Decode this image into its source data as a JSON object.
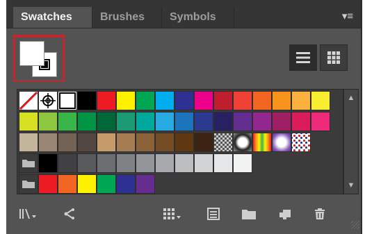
{
  "panel": {
    "tabs": [
      {
        "label": "Swatches",
        "active": true
      },
      {
        "label": "Brushes",
        "active": false
      },
      {
        "label": "Symbols",
        "active": false
      }
    ],
    "menu_icon": "panel-menu-icon"
  },
  "fill_stroke": {
    "fill_color": "#ffffff",
    "stroke_color": "#000000",
    "highlight_color": "#c1272d"
  },
  "view_modes": [
    {
      "name": "list-view",
      "icon": "list-view-icon",
      "active": true
    },
    {
      "name": "thumbnail-view",
      "icon": "thumbnail-view-icon",
      "active": false
    }
  ],
  "swatch_rows": [
    [
      "none",
      "registration",
      "#ffffff",
      "#000000",
      "#ed1c24",
      "#fff200",
      "#00a651",
      "#00aeef",
      "#2e3192",
      "#ec008c",
      "#be1e2d",
      "#ef4136",
      "#f26522",
      "#f7941d",
      "#fbb040",
      "#f9ed32"
    ],
    [
      "#d7df23",
      "#8dc63f",
      "#39b54a",
      "#009444",
      "#006838",
      "#1c9a73",
      "#00a79d",
      "#27aae1",
      "#1c75bc",
      "#2b3990",
      "#262262",
      "#662d91",
      "#92278f",
      "#9e1f63",
      "#da1c5c",
      "#ee2a7b"
    ],
    [
      "#c2b59b",
      "#998675",
      "#736357",
      "#534741",
      "#c69c6d",
      "#a67c52",
      "#8c6239",
      "#754c24",
      "#603913",
      "#3c2415",
      "pattern-checker",
      "pattern-radial",
      "pattern-stripes",
      "pattern-glow",
      "pattern-dots"
    ],
    [
      "folder",
      "#000000",
      "#414042",
      "#58595b",
      "#6d6e71",
      "#808285",
      "#939598",
      "#a7a9ac",
      "#bcbec0",
      "#d1d3d4",
      "#e6e7e8",
      "#f1f2f2"
    ],
    [
      "folder",
      "#ed1c24",
      "#f26522",
      "#fff200",
      "#00a651",
      "#2e3192",
      "#662d91"
    ]
  ],
  "toolbar": [
    {
      "name": "swatch-libraries-menu",
      "icon": "library-icon"
    },
    {
      "name": "show-swatch-kinds-menu",
      "icon": "share-icon"
    },
    {
      "name": "swatch-options",
      "icon": "swatch-grid-icon"
    },
    {
      "name": "new-color-group",
      "icon": "color-group-icon"
    },
    {
      "name": "new-folder",
      "icon": "folder-icon"
    },
    {
      "name": "new-swatch",
      "icon": "new-swatch-icon"
    },
    {
      "name": "delete-swatch",
      "icon": "trash-icon"
    }
  ]
}
